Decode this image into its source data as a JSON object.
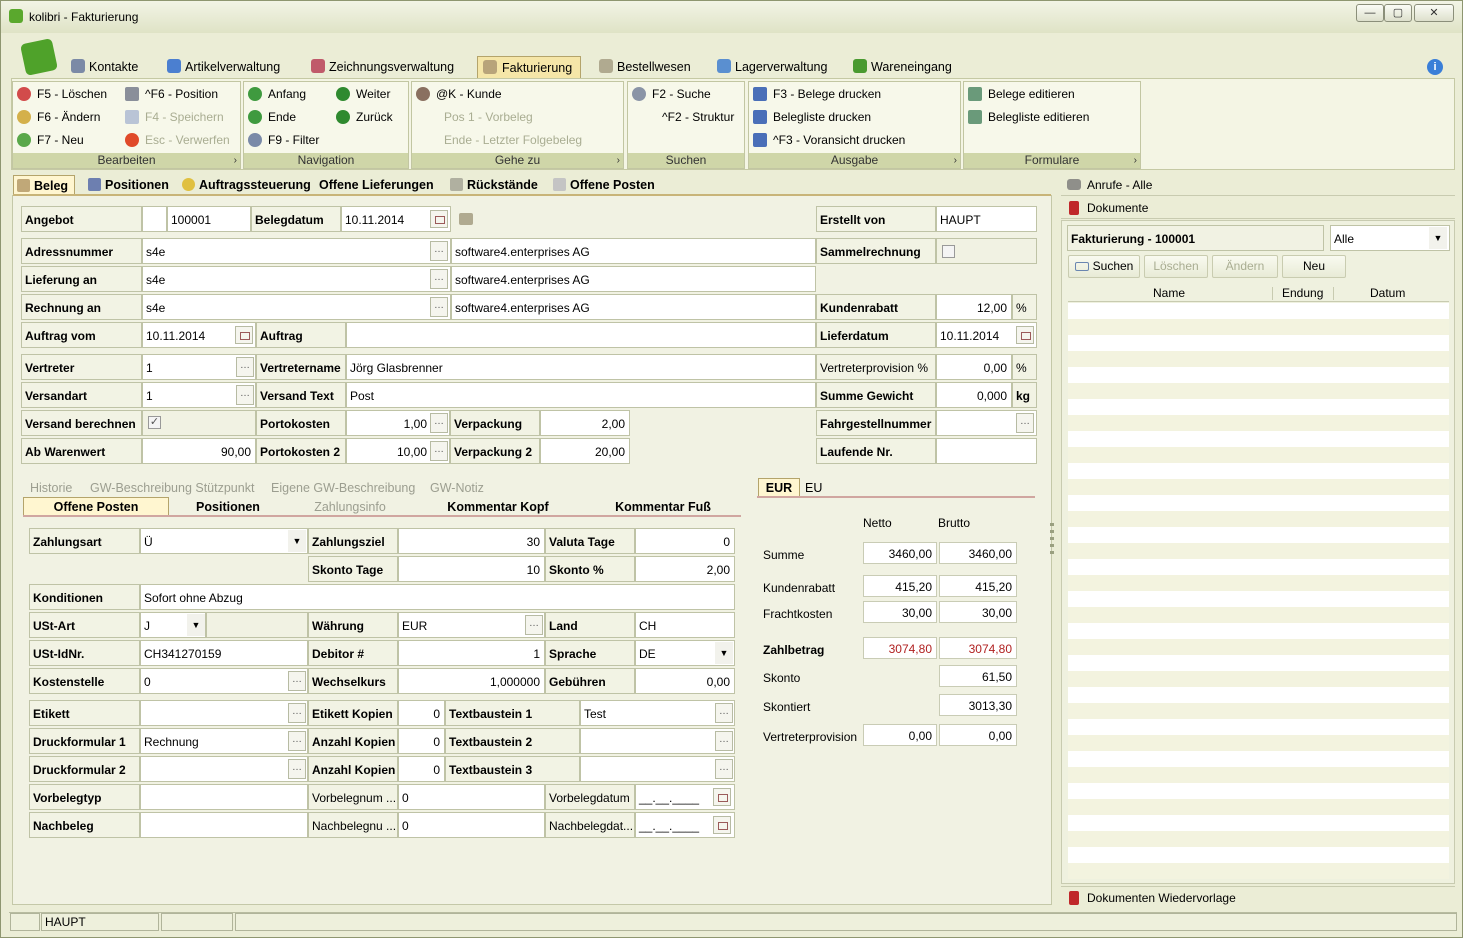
{
  "window": {
    "title": "kolibri - Fakturierung"
  },
  "main_tabs": [
    "Kontakte",
    "Artikelverwaltung",
    "Zeichnungsverwaltung",
    "Fakturierung",
    "Bestellwesen",
    "Lagerverwaltung",
    "Wareneingang"
  ],
  "ribbon": {
    "bearbeiten": {
      "caption": "Bearbeiten",
      "items": [
        "F5 - Löschen",
        "F6 - Ändern",
        "F7 - Neu",
        "^F6 - Position",
        "F4 - Speichern",
        "Esc - Verwerfen"
      ]
    },
    "navigation": {
      "caption": "Navigation",
      "items": [
        "Anfang",
        "Ende",
        "F9 - Filter",
        "Weiter",
        "Zurück"
      ]
    },
    "gehezu": {
      "caption": "Gehe zu",
      "items": [
        "@K - Kunde",
        "Pos 1 - Vorbeleg",
        "Ende - Letzter Folgebeleg"
      ]
    },
    "suchen": {
      "caption": "Suchen",
      "items": [
        "F2 - Suche",
        "^F2 - Struktur"
      ]
    },
    "ausgabe": {
      "caption": "Ausgabe",
      "items": [
        "F3 - Belege drucken",
        "Belegliste drucken",
        "^F3 - Voransicht drucken"
      ]
    },
    "formulare": {
      "caption": "Formulare",
      "items": [
        "Belege editieren",
        "Belegliste editieren"
      ]
    }
  },
  "sub_tabs": [
    "Beleg",
    "Positionen",
    "Auftragssteuerung",
    "Offene Lieferungen",
    "Rückstände",
    "Offene Posten"
  ],
  "header": {
    "angebot_label": "Angebot",
    "angebot_value": "100001",
    "belegdatum_label": "Belegdatum",
    "belegdatum_value": "10.11.2014",
    "erstellt_label": "Erstellt von",
    "erstellt_value": "HAUPT",
    "adress_label": "Adressnummer",
    "adress_value": "s4e",
    "adress_name": "software4.enterprises AG",
    "sammel_label": "Sammelrechnung",
    "liefer_label": "Lieferung an",
    "liefer_value": "s4e",
    "liefer_name": "software4.enterprises AG",
    "rechnung_label": "Rechnung an",
    "rechnung_value": "s4e",
    "rechnung_name": "software4.enterprises AG",
    "kundenrabatt_label": "Kundenrabatt",
    "kundenrabatt_value": "12,00",
    "kundenrabatt_unit": "%",
    "auftragvom_label": "Auftrag vom",
    "auftragvom_value": "10.11.2014",
    "auftrag_label": "Auftrag",
    "lieferdatum_label": "Lieferdatum",
    "lieferdatum_value": "10.11.2014",
    "vertreter_label": "Vertreter",
    "vertreter_value": "1",
    "vertretername_label": "Vertretername",
    "vertretername_value": "Jörg Glasbrenner",
    "provision_label": "Vertreterprovision %",
    "provision_value": "0,00",
    "provision_unit": "%",
    "versandart_label": "Versandart",
    "versandart_value": "1",
    "versandtext_label": "Versand Text",
    "versandtext_value": "Post",
    "gewicht_label": "Summe Gewicht",
    "gewicht_value": "0,000",
    "gewicht_unit": "kg",
    "versandber_label": "Versand berechnen",
    "porto_label": "Portokosten",
    "porto_value": "1,00",
    "verpackung_label": "Verpackung",
    "verpackung_value": "2,00",
    "fahrgestell_label": "Fahrgestellnummer",
    "abwaren_label": "Ab Warenwert",
    "abwaren_value": "90,00",
    "porto2_label": "Portokosten 2",
    "porto2_value": "10,00",
    "verpackung2_label": "Verpackung 2",
    "verpackung2_value": "20,00",
    "laufende_label": "Laufende Nr."
  },
  "lower_tabs_row1": [
    "Historie",
    "GW-Beschreibung Stützpunkt",
    "Eigene GW-Beschreibung",
    "GW-Notiz"
  ],
  "lower_tabs_row2": [
    "Offene Posten",
    "Positionen",
    "Zahlungsinfo",
    "Kommentar Kopf",
    "Kommentar Fuß"
  ],
  "payment": {
    "zahlungsart_label": "Zahlungsart",
    "zahlungsart_value": "Ü",
    "zahlungsziel_label": "Zahlungsziel",
    "zahlungsziel_value": "30",
    "valuta_label": "Valuta Tage",
    "valuta_value": "0",
    "skontotage_label": "Skonto Tage",
    "skontotage_value": "10",
    "skonto_label": "Skonto %",
    "skonto_value": "2,00",
    "konditionen_label": "Konditionen",
    "konditionen_value": "Sofort ohne Abzug",
    "ustart_label": "USt-Art",
    "ustart_value": "J",
    "waehrung_label": "Währung",
    "waehrung_value": "EUR",
    "land_label": "Land",
    "land_value": "CH",
    "ustid_label": "USt-IdNr.",
    "ustid_value": "CH341270159",
    "debitor_label": "Debitor #",
    "debitor_value": "1",
    "sprache_label": "Sprache",
    "sprache_value": "DE",
    "kosten_label": "Kostenstelle",
    "kosten_value": "0",
    "wechsel_label": "Wechselkurs",
    "wechsel_value": "1,000000",
    "gebuehren_label": "Gebühren",
    "gebuehren_value": "0,00",
    "etikett_label": "Etikett",
    "etikettkop_label": "Etikett Kopien",
    "etikettkop_value": "0",
    "tb1_label": "Textbaustein 1",
    "tb1_value": "Test",
    "druck1_label": "Druckformular 1",
    "druck1_value": "Rechnung",
    "anz1_label": "Anzahl Kopien",
    "anz1_value": "0",
    "tb2_label": "Textbaustein 2",
    "druck2_label": "Druckformular 2",
    "anz2_label": "Anzahl Kopien",
    "anz2_value": "0",
    "tb3_label": "Textbaustein 3",
    "vortyp_label": "Vorbelegtyp",
    "vornum_label": "Vorbelegnum ...",
    "vornum_value": "0",
    "vordat_label": "Vorbelegdatum",
    "vordat_value": "__.__.____",
    "nach_label": "Nachbeleg",
    "nachnum_label": "Nachbelegnu ...",
    "nachnum_value": "0",
    "nachdat_label": "Nachbelegdat...",
    "nachdat_value": "__.__.____"
  },
  "summary": {
    "tabs": [
      "EUR",
      "EU"
    ],
    "netto": "Netto",
    "brutto": "Brutto",
    "rows": [
      {
        "label": "Summe",
        "netto": "3460,00",
        "brutto": "3460,00"
      },
      {
        "label": "Kundenrabatt",
        "netto": "415,20",
        "brutto": "415,20"
      },
      {
        "label": "Frachtkosten",
        "netto": "30,00",
        "brutto": "30,00"
      },
      {
        "label": "Zahlbetrag",
        "netto": "3074,80",
        "brutto": "3074,80"
      }
    ],
    "skonto_label": "Skonto",
    "skonto_value": "61,50",
    "skontiert_label": "Skontiert",
    "skontiert_value": "3013,30",
    "vprov_label": "Vertreterprovision",
    "vprov_netto": "0,00",
    "vprov_brutto": "0,00"
  },
  "right_panel": {
    "anrufe": "Anrufe - Alle",
    "dokumente": "Dokumente",
    "doc_title": "Fakturierung - 100001",
    "filter_value": "Alle",
    "buttons": [
      "Suchen",
      "Löschen",
      "Ändern",
      "Neu"
    ],
    "columns": [
      "Name",
      "Endung",
      "Datum"
    ],
    "wiedervorlage": "Dokumenten Wiedervorlage"
  },
  "status": {
    "user": "HAUPT"
  }
}
